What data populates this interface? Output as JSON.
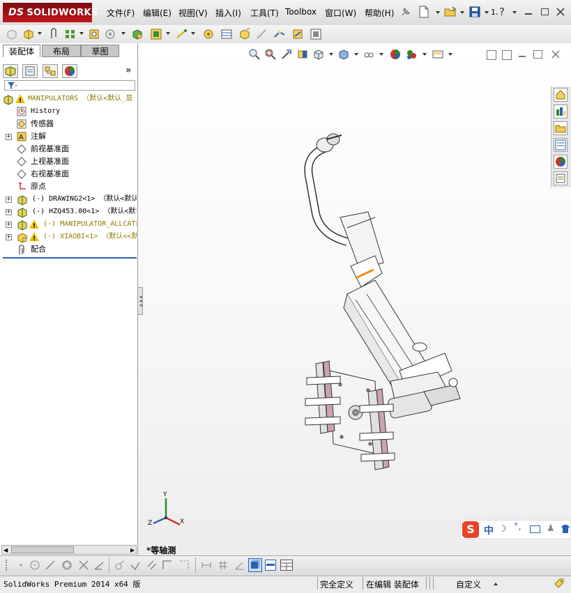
{
  "app": {
    "logo_brand": "SOLIDWORKS",
    "logo_prefix": "DS"
  },
  "menu": [
    "文件(F)",
    "编辑(E)",
    "视图(V)",
    "插入(I)",
    "工具(T)",
    "Toolbox",
    "窗口(W)",
    "帮助(H)"
  ],
  "titlebar_right": {
    "version_fragment": "1.",
    "help": "?"
  },
  "tabs": [
    "装配体",
    "布局",
    "草图"
  ],
  "tree": {
    "root": "MANIPULATORS （默认<默认_显",
    "items": [
      {
        "label": "History",
        "kind": "history"
      },
      {
        "label": "传感器",
        "kind": "sensor"
      },
      {
        "label": "注解",
        "kind": "annotation",
        "expand": "+"
      },
      {
        "label": "前视基准面",
        "kind": "plane"
      },
      {
        "label": "上视基准面",
        "kind": "plane"
      },
      {
        "label": "右视基准面",
        "kind": "plane"
      },
      {
        "label": "原点",
        "kind": "origin"
      },
      {
        "label": "(-) DRAWING2<1> （默认<默认",
        "kind": "part",
        "expand": "+"
      },
      {
        "label": "(-) HZQ453.00<1> （默认<默认",
        "kind": "part",
        "expand": "+"
      },
      {
        "label": "(-) MANIPULATOR_ALLCATE",
        "kind": "asm-warn",
        "expand": "+"
      },
      {
        "label": "(-) XIAOBI<1> （默认<<默",
        "kind": "asm-warn",
        "expand": "+"
      },
      {
        "label": "配合",
        "kind": "mates"
      }
    ]
  },
  "viewport": {
    "view_name": "*等轴测",
    "triad": {
      "x": "X",
      "y": "Y",
      "z": "Z"
    }
  },
  "ime": {
    "mode": "中"
  },
  "status": {
    "product": "SolidWorks Premium 2014 x64 版",
    "state": "完全定义",
    "editing": "在编辑 装配体",
    "units": "自定义"
  },
  "colors": {
    "brand": "#c4141c",
    "accent": "#2a62b0",
    "warning": "#f0c000",
    "ime": "#e8432a"
  }
}
